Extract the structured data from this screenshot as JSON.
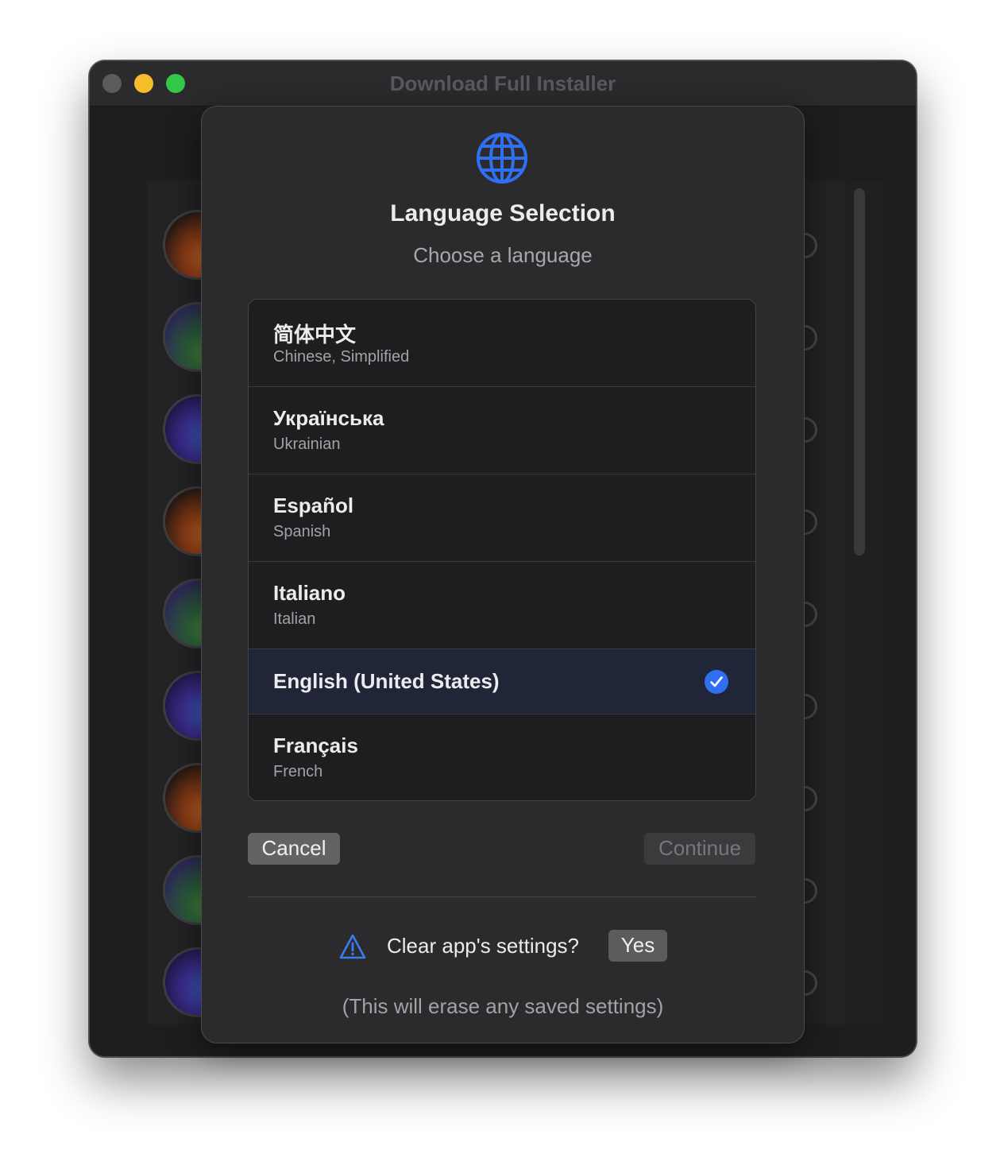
{
  "window": {
    "title": "Download Full Installer"
  },
  "dialog": {
    "icon": "globe-icon",
    "title": "Language Selection",
    "subtitle": "Choose a language",
    "languages": [
      {
        "native": "简体中文",
        "english": "Chinese, Simplified",
        "selected": false
      },
      {
        "native": "Українська",
        "english": "Ukrainian",
        "selected": false
      },
      {
        "native": "Español",
        "english": "Spanish",
        "selected": false
      },
      {
        "native": "Italiano",
        "english": "Italian",
        "selected": false
      },
      {
        "native": "English (United States)",
        "english": "",
        "selected": true
      },
      {
        "native": "Français",
        "english": "French",
        "selected": false
      }
    ],
    "buttons": {
      "cancel": "Cancel",
      "continue": "Continue"
    },
    "clear_settings": {
      "icon": "warning-triangle-icon",
      "label": "Clear app's settings?",
      "yes": "Yes",
      "note": "(This will erase any saved settings)"
    }
  },
  "colors": {
    "accent": "#2f6ff0",
    "window_bg": "#1e1e21",
    "sheet_bg": "#2b2b2d",
    "close": "#5b5b5e",
    "minimize": "#f6bd2b",
    "maximize": "#33c748"
  }
}
